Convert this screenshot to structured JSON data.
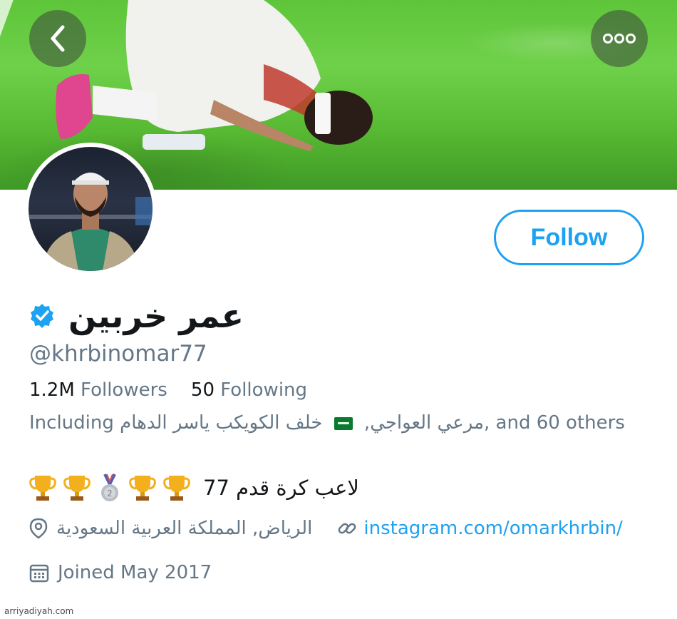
{
  "header": {
    "back_icon": "chevron-left-icon",
    "more_icon": "more-horizontal-icon"
  },
  "profile": {
    "display_name": "عمر خربين",
    "verified": true,
    "handle": "@khrbinomar77",
    "follow_label": "Follow",
    "followers_count": "1.2M",
    "followers_label": "Followers",
    "following_count": "50",
    "following_label": "Following",
    "including": {
      "prefix": "Including",
      "name_1": "ياسر الدهام",
      "name_2": "خلف الكويكب",
      "name_3": ",مرعي العواجي",
      "suffix": ", and 60 others"
    },
    "bio": "لاعب كرة قدم 77",
    "bio_emojis": [
      "trophy",
      "trophy",
      "medal",
      "trophy",
      "trophy"
    ],
    "location": "الرياض, المملكة العربية السعودية",
    "website": "instagram.com/omarkhrbin/",
    "joined": "Joined May 2017"
  },
  "colors": {
    "accent": "#1da1f2",
    "secondary_text": "#657786",
    "primary_text": "#14171a"
  },
  "watermark": "arriyadiyah.com"
}
